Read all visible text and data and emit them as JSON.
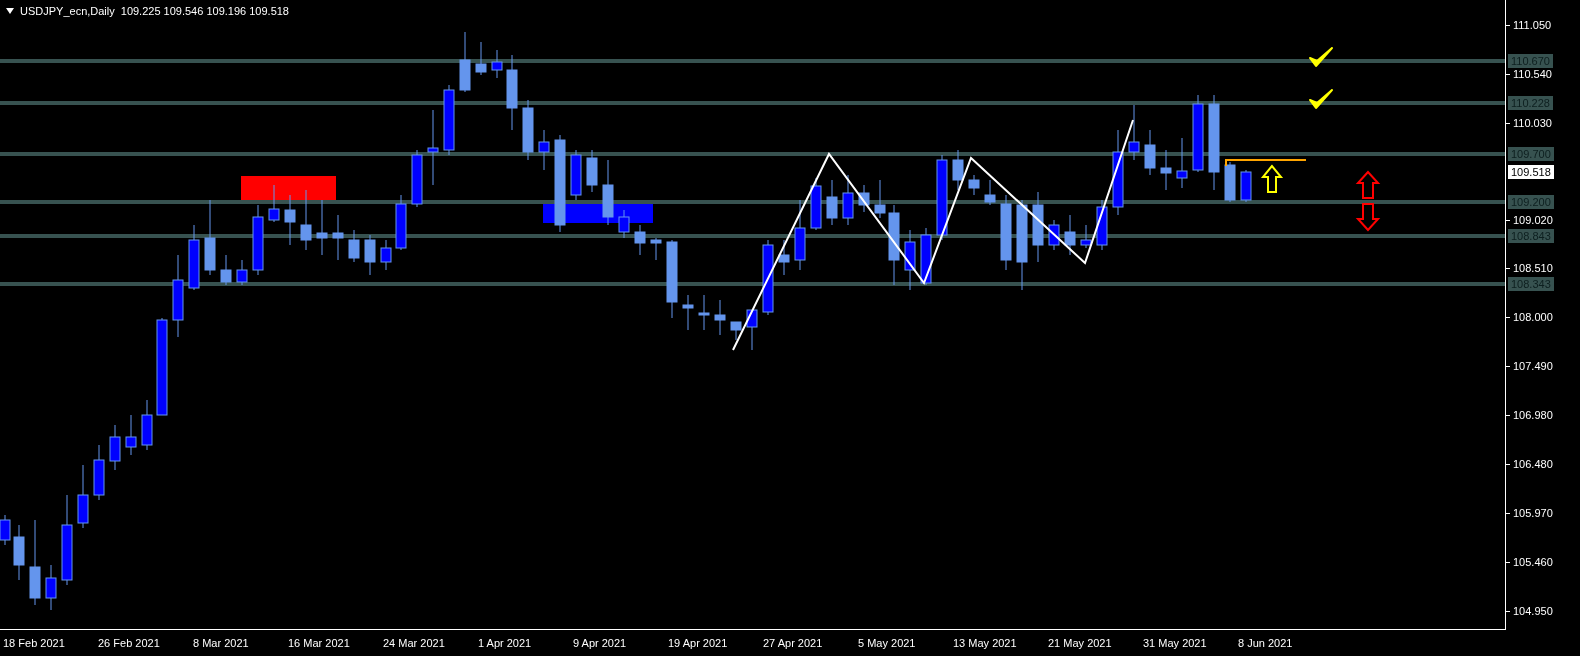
{
  "header": {
    "symbol": "USDJPY_ecn,Daily",
    "ohlc": "109.225 109.546 109.196 109.518"
  },
  "price_axis": {
    "ticks": [
      "111.050",
      "110.540",
      "110.030",
      "109.020",
      "108.510",
      "108.000",
      "107.490",
      "106.980",
      "106.480",
      "105.970",
      "105.460",
      "104.950"
    ],
    "levels": [
      "110.670",
      "110.228",
      "109.700",
      "109.200",
      "108.843",
      "108.343"
    ],
    "current_price": "109.518"
  },
  "date_axis": [
    "18 Feb 2021",
    "26 Feb 2021",
    "8 Mar 2021",
    "16 Mar 2021",
    "24 Mar 2021",
    "1 Apr 2021",
    "9 Apr 2021",
    "19 Apr 2021",
    "27 Apr 2021",
    "5 May 2021",
    "13 May 2021",
    "21 May 2021",
    "31 May 2021",
    "8 Jun 2021"
  ]
}
